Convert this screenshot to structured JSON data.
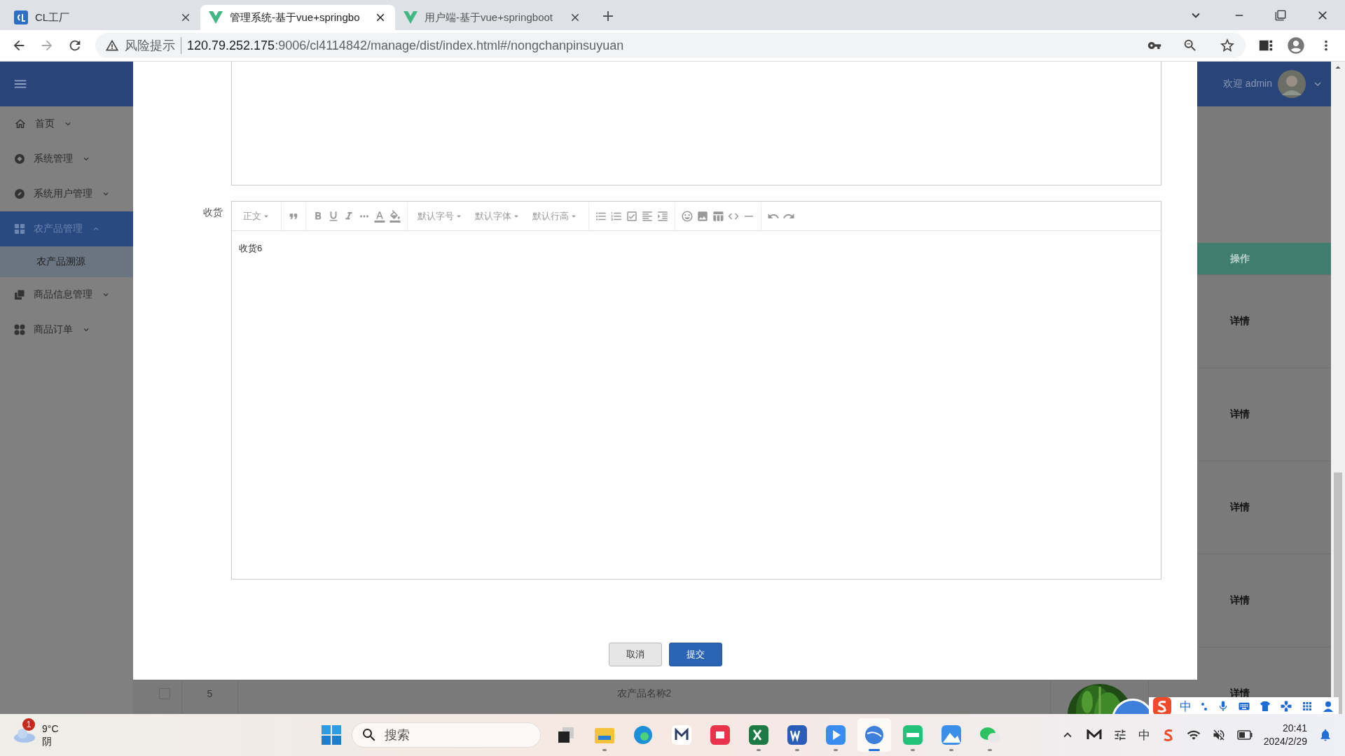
{
  "browser": {
    "tabs": [
      {
        "title": "CL工厂",
        "selected": false
      },
      {
        "title": "管理系统-基于vue+springbo",
        "selected": true
      },
      {
        "title": "用户端-基于vue+springboot",
        "selected": false
      }
    ],
    "warning": "风险提示",
    "url": {
      "host": "120.79.252.175",
      "path": ":9006/cl4114842/manage/dist/index.html#/nongchanpinsuyuan"
    }
  },
  "sidebar": {
    "items": [
      {
        "label": "首页",
        "selected": false,
        "expanded": false
      },
      {
        "label": "系统管理",
        "selected": false,
        "expanded": false
      },
      {
        "label": "系统用户管理",
        "selected": false,
        "expanded": false
      },
      {
        "label": "农产品管理",
        "selected": true,
        "expanded": true,
        "children": [
          {
            "label": "农产品溯源",
            "selected": true
          }
        ]
      },
      {
        "label": "商品信息管理",
        "selected": false,
        "expanded": false
      },
      {
        "label": "商品订单",
        "selected": false,
        "expanded": false
      }
    ]
  },
  "header": {
    "welcome": "欢迎 admin"
  },
  "table": {
    "action_column": "操作",
    "rows": [
      {
        "action": "详情"
      },
      {
        "action": "详情"
      },
      {
        "action": "详情"
      },
      {
        "action": "详情"
      },
      {
        "index": "5",
        "checked": false,
        "name": "农产品名称2",
        "action": "详情"
      }
    ]
  },
  "dialog": {
    "field_label": "收货",
    "toolbar": {
      "heading": "正文",
      "menus": [
        "默认字号",
        "默认字体",
        "默认行高"
      ]
    },
    "content": "收货6",
    "buttons": [
      {
        "label": "取消",
        "kind": "default"
      },
      {
        "label": "提交",
        "kind": "primary"
      }
    ]
  },
  "ime_bar": {
    "mode": "中"
  },
  "taskbar": {
    "weather": {
      "badge": "1",
      "temperature": "9°C",
      "condition": "阴"
    },
    "search": {
      "placeholder": "搜索"
    },
    "apps": [
      {
        "running": false,
        "selected": false
      },
      {
        "running": true,
        "selected": false
      },
      {
        "running": false,
        "selected": false
      },
      {
        "running": false,
        "selected": false
      },
      {
        "running": false,
        "selected": false
      },
      {
        "running": true,
        "selected": false
      },
      {
        "running": true,
        "selected": false
      },
      {
        "running": true,
        "selected": false
      },
      {
        "running": true,
        "selected": true
      },
      {
        "running": true,
        "selected": false
      },
      {
        "running": true,
        "selected": false
      },
      {
        "running": true,
        "selected": false
      }
    ],
    "tray_ime": "中",
    "time": "20:41",
    "date": "2024/2/29"
  }
}
